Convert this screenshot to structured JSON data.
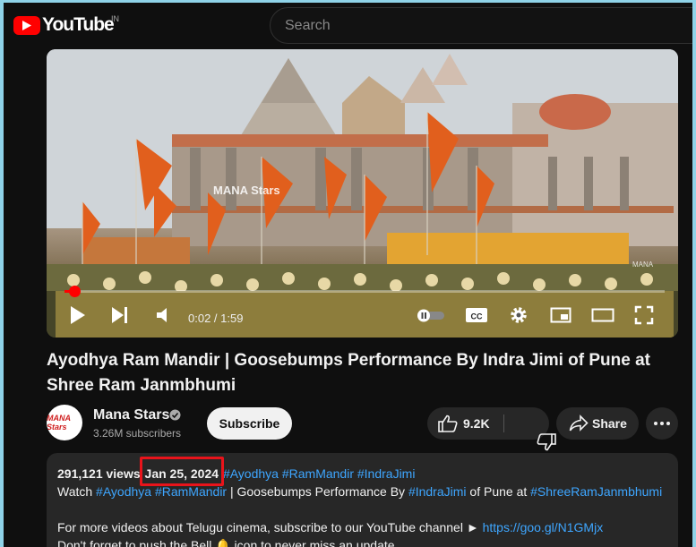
{
  "header": {
    "logo_text": "YouTube",
    "country_code": "IN",
    "search_placeholder": "Search"
  },
  "player": {
    "watermark": "MANA Stars",
    "corner_watermark": "MANA",
    "time_current": "0:02",
    "time_total": "1:59",
    "time_display": "0:02 / 1:59",
    "progress": 0.017
  },
  "video": {
    "title": "Ayodhya Ram Mandir | Goosebumps Performance By Indra Jimi of Pune at Shree Ram Janmbhumi"
  },
  "channel": {
    "avatar_text": "MANA Stars",
    "name": "Mana Stars",
    "subscribers": "3.26M subscribers",
    "subscribe_label": "Subscribe"
  },
  "actions": {
    "like_count": "9.2K",
    "share_label": "Share"
  },
  "description": {
    "views": "291,121 views",
    "date": "Jan 25, 2024",
    "hashtags": [
      "#Ayodhya",
      "#RamMandir",
      "#IndraJimi"
    ],
    "line2_prefix": "Watch",
    "line2_tag1": "#Ayodhya",
    "line2_tag2": "#RamMandir",
    "line2_mid": "| Goosebumps Performance By",
    "line2_tag3": "#IndraJimi",
    "line2_mid2": "of Pune at",
    "line2_tag4": "#ShreeRamJanmbhumi",
    "line4_text": "For more videos about Telugu cinema, subscribe to our YouTube channel ►",
    "line4_link": "https://goo.gl/N1GMjx",
    "line5_text": "Don't forget to push the Bell 🔔 icon to never miss an update"
  },
  "colors": {
    "accent": "#ff0000",
    "link": "#3ea6ff",
    "highlight_box": "#e8141b"
  }
}
